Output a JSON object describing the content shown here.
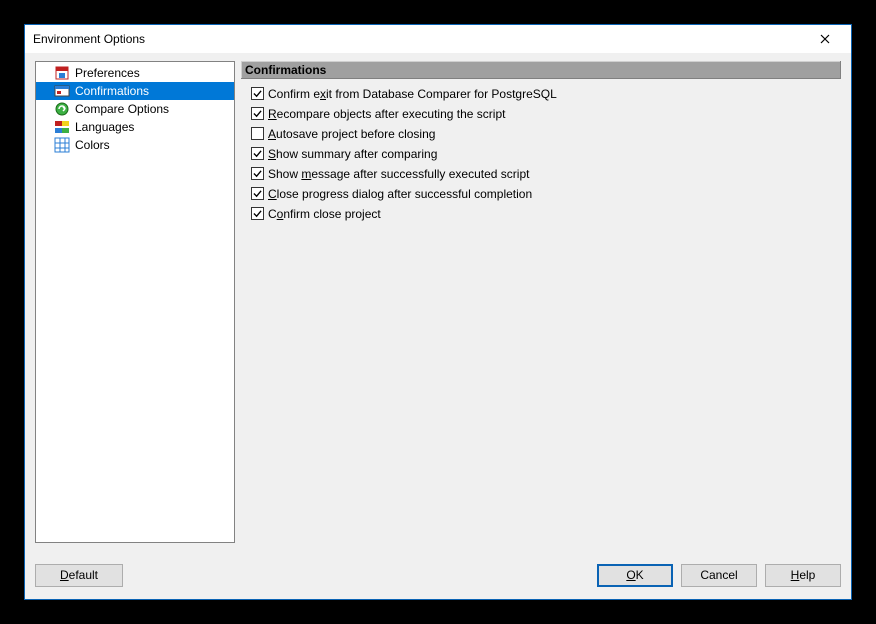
{
  "window": {
    "title": "Environment Options"
  },
  "nav": {
    "items": [
      {
        "label": "Preferences"
      },
      {
        "label": "Confirmations"
      },
      {
        "label": "Compare Options"
      },
      {
        "label": "Languages"
      },
      {
        "label": "Colors"
      }
    ],
    "selected_index": 1
  },
  "section": {
    "header": "Confirmations",
    "options": [
      {
        "label_html": "Confirm e<u>x</u>it from Database Comparer for PostgreSQL",
        "checked": true
      },
      {
        "label_html": "<u>R</u>ecompare objects after executing the script",
        "checked": true
      },
      {
        "label_html": "<u>A</u>utosave project before closing",
        "checked": false
      },
      {
        "label_html": "<u>S</u>how summary after comparing",
        "checked": true
      },
      {
        "label_html": "Show <u>m</u>essage after successfully executed script",
        "checked": true
      },
      {
        "label_html": "<u>C</u>lose progress dialog after successful completion",
        "checked": true
      },
      {
        "label_html": "C<u>o</u>nfirm close project",
        "checked": true
      }
    ]
  },
  "buttons": {
    "default": "<u>D</u>efault",
    "ok": "<u>O</u>K",
    "cancel": "Cancel",
    "help": "<u>H</u>elp"
  }
}
